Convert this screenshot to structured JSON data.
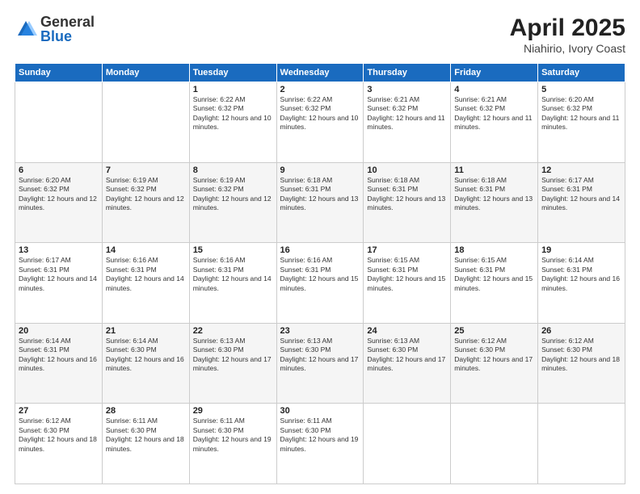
{
  "header": {
    "logo_general": "General",
    "logo_blue": "Blue",
    "title": "April 2025",
    "subtitle": "Niahirio, Ivory Coast"
  },
  "calendar": {
    "headers": [
      "Sunday",
      "Monday",
      "Tuesday",
      "Wednesday",
      "Thursday",
      "Friday",
      "Saturday"
    ],
    "weeks": [
      [
        {
          "day": "",
          "info": ""
        },
        {
          "day": "",
          "info": ""
        },
        {
          "day": "1",
          "info": "Sunrise: 6:22 AM\nSunset: 6:32 PM\nDaylight: 12 hours and 10 minutes."
        },
        {
          "day": "2",
          "info": "Sunrise: 6:22 AM\nSunset: 6:32 PM\nDaylight: 12 hours and 10 minutes."
        },
        {
          "day": "3",
          "info": "Sunrise: 6:21 AM\nSunset: 6:32 PM\nDaylight: 12 hours and 11 minutes."
        },
        {
          "day": "4",
          "info": "Sunrise: 6:21 AM\nSunset: 6:32 PM\nDaylight: 12 hours and 11 minutes."
        },
        {
          "day": "5",
          "info": "Sunrise: 6:20 AM\nSunset: 6:32 PM\nDaylight: 12 hours and 11 minutes."
        }
      ],
      [
        {
          "day": "6",
          "info": "Sunrise: 6:20 AM\nSunset: 6:32 PM\nDaylight: 12 hours and 12 minutes."
        },
        {
          "day": "7",
          "info": "Sunrise: 6:19 AM\nSunset: 6:32 PM\nDaylight: 12 hours and 12 minutes."
        },
        {
          "day": "8",
          "info": "Sunrise: 6:19 AM\nSunset: 6:32 PM\nDaylight: 12 hours and 12 minutes."
        },
        {
          "day": "9",
          "info": "Sunrise: 6:18 AM\nSunset: 6:31 PM\nDaylight: 12 hours and 13 minutes."
        },
        {
          "day": "10",
          "info": "Sunrise: 6:18 AM\nSunset: 6:31 PM\nDaylight: 12 hours and 13 minutes."
        },
        {
          "day": "11",
          "info": "Sunrise: 6:18 AM\nSunset: 6:31 PM\nDaylight: 12 hours and 13 minutes."
        },
        {
          "day": "12",
          "info": "Sunrise: 6:17 AM\nSunset: 6:31 PM\nDaylight: 12 hours and 14 minutes."
        }
      ],
      [
        {
          "day": "13",
          "info": "Sunrise: 6:17 AM\nSunset: 6:31 PM\nDaylight: 12 hours and 14 minutes."
        },
        {
          "day": "14",
          "info": "Sunrise: 6:16 AM\nSunset: 6:31 PM\nDaylight: 12 hours and 14 minutes."
        },
        {
          "day": "15",
          "info": "Sunrise: 6:16 AM\nSunset: 6:31 PM\nDaylight: 12 hours and 14 minutes."
        },
        {
          "day": "16",
          "info": "Sunrise: 6:16 AM\nSunset: 6:31 PM\nDaylight: 12 hours and 15 minutes."
        },
        {
          "day": "17",
          "info": "Sunrise: 6:15 AM\nSunset: 6:31 PM\nDaylight: 12 hours and 15 minutes."
        },
        {
          "day": "18",
          "info": "Sunrise: 6:15 AM\nSunset: 6:31 PM\nDaylight: 12 hours and 15 minutes."
        },
        {
          "day": "19",
          "info": "Sunrise: 6:14 AM\nSunset: 6:31 PM\nDaylight: 12 hours and 16 minutes."
        }
      ],
      [
        {
          "day": "20",
          "info": "Sunrise: 6:14 AM\nSunset: 6:31 PM\nDaylight: 12 hours and 16 minutes."
        },
        {
          "day": "21",
          "info": "Sunrise: 6:14 AM\nSunset: 6:30 PM\nDaylight: 12 hours and 16 minutes."
        },
        {
          "day": "22",
          "info": "Sunrise: 6:13 AM\nSunset: 6:30 PM\nDaylight: 12 hours and 17 minutes."
        },
        {
          "day": "23",
          "info": "Sunrise: 6:13 AM\nSunset: 6:30 PM\nDaylight: 12 hours and 17 minutes."
        },
        {
          "day": "24",
          "info": "Sunrise: 6:13 AM\nSunset: 6:30 PM\nDaylight: 12 hours and 17 minutes."
        },
        {
          "day": "25",
          "info": "Sunrise: 6:12 AM\nSunset: 6:30 PM\nDaylight: 12 hours and 17 minutes."
        },
        {
          "day": "26",
          "info": "Sunrise: 6:12 AM\nSunset: 6:30 PM\nDaylight: 12 hours and 18 minutes."
        }
      ],
      [
        {
          "day": "27",
          "info": "Sunrise: 6:12 AM\nSunset: 6:30 PM\nDaylight: 12 hours and 18 minutes."
        },
        {
          "day": "28",
          "info": "Sunrise: 6:11 AM\nSunset: 6:30 PM\nDaylight: 12 hours and 18 minutes."
        },
        {
          "day": "29",
          "info": "Sunrise: 6:11 AM\nSunset: 6:30 PM\nDaylight: 12 hours and 19 minutes."
        },
        {
          "day": "30",
          "info": "Sunrise: 6:11 AM\nSunset: 6:30 PM\nDaylight: 12 hours and 19 minutes."
        },
        {
          "day": "",
          "info": ""
        },
        {
          "day": "",
          "info": ""
        },
        {
          "day": "",
          "info": ""
        }
      ]
    ]
  }
}
